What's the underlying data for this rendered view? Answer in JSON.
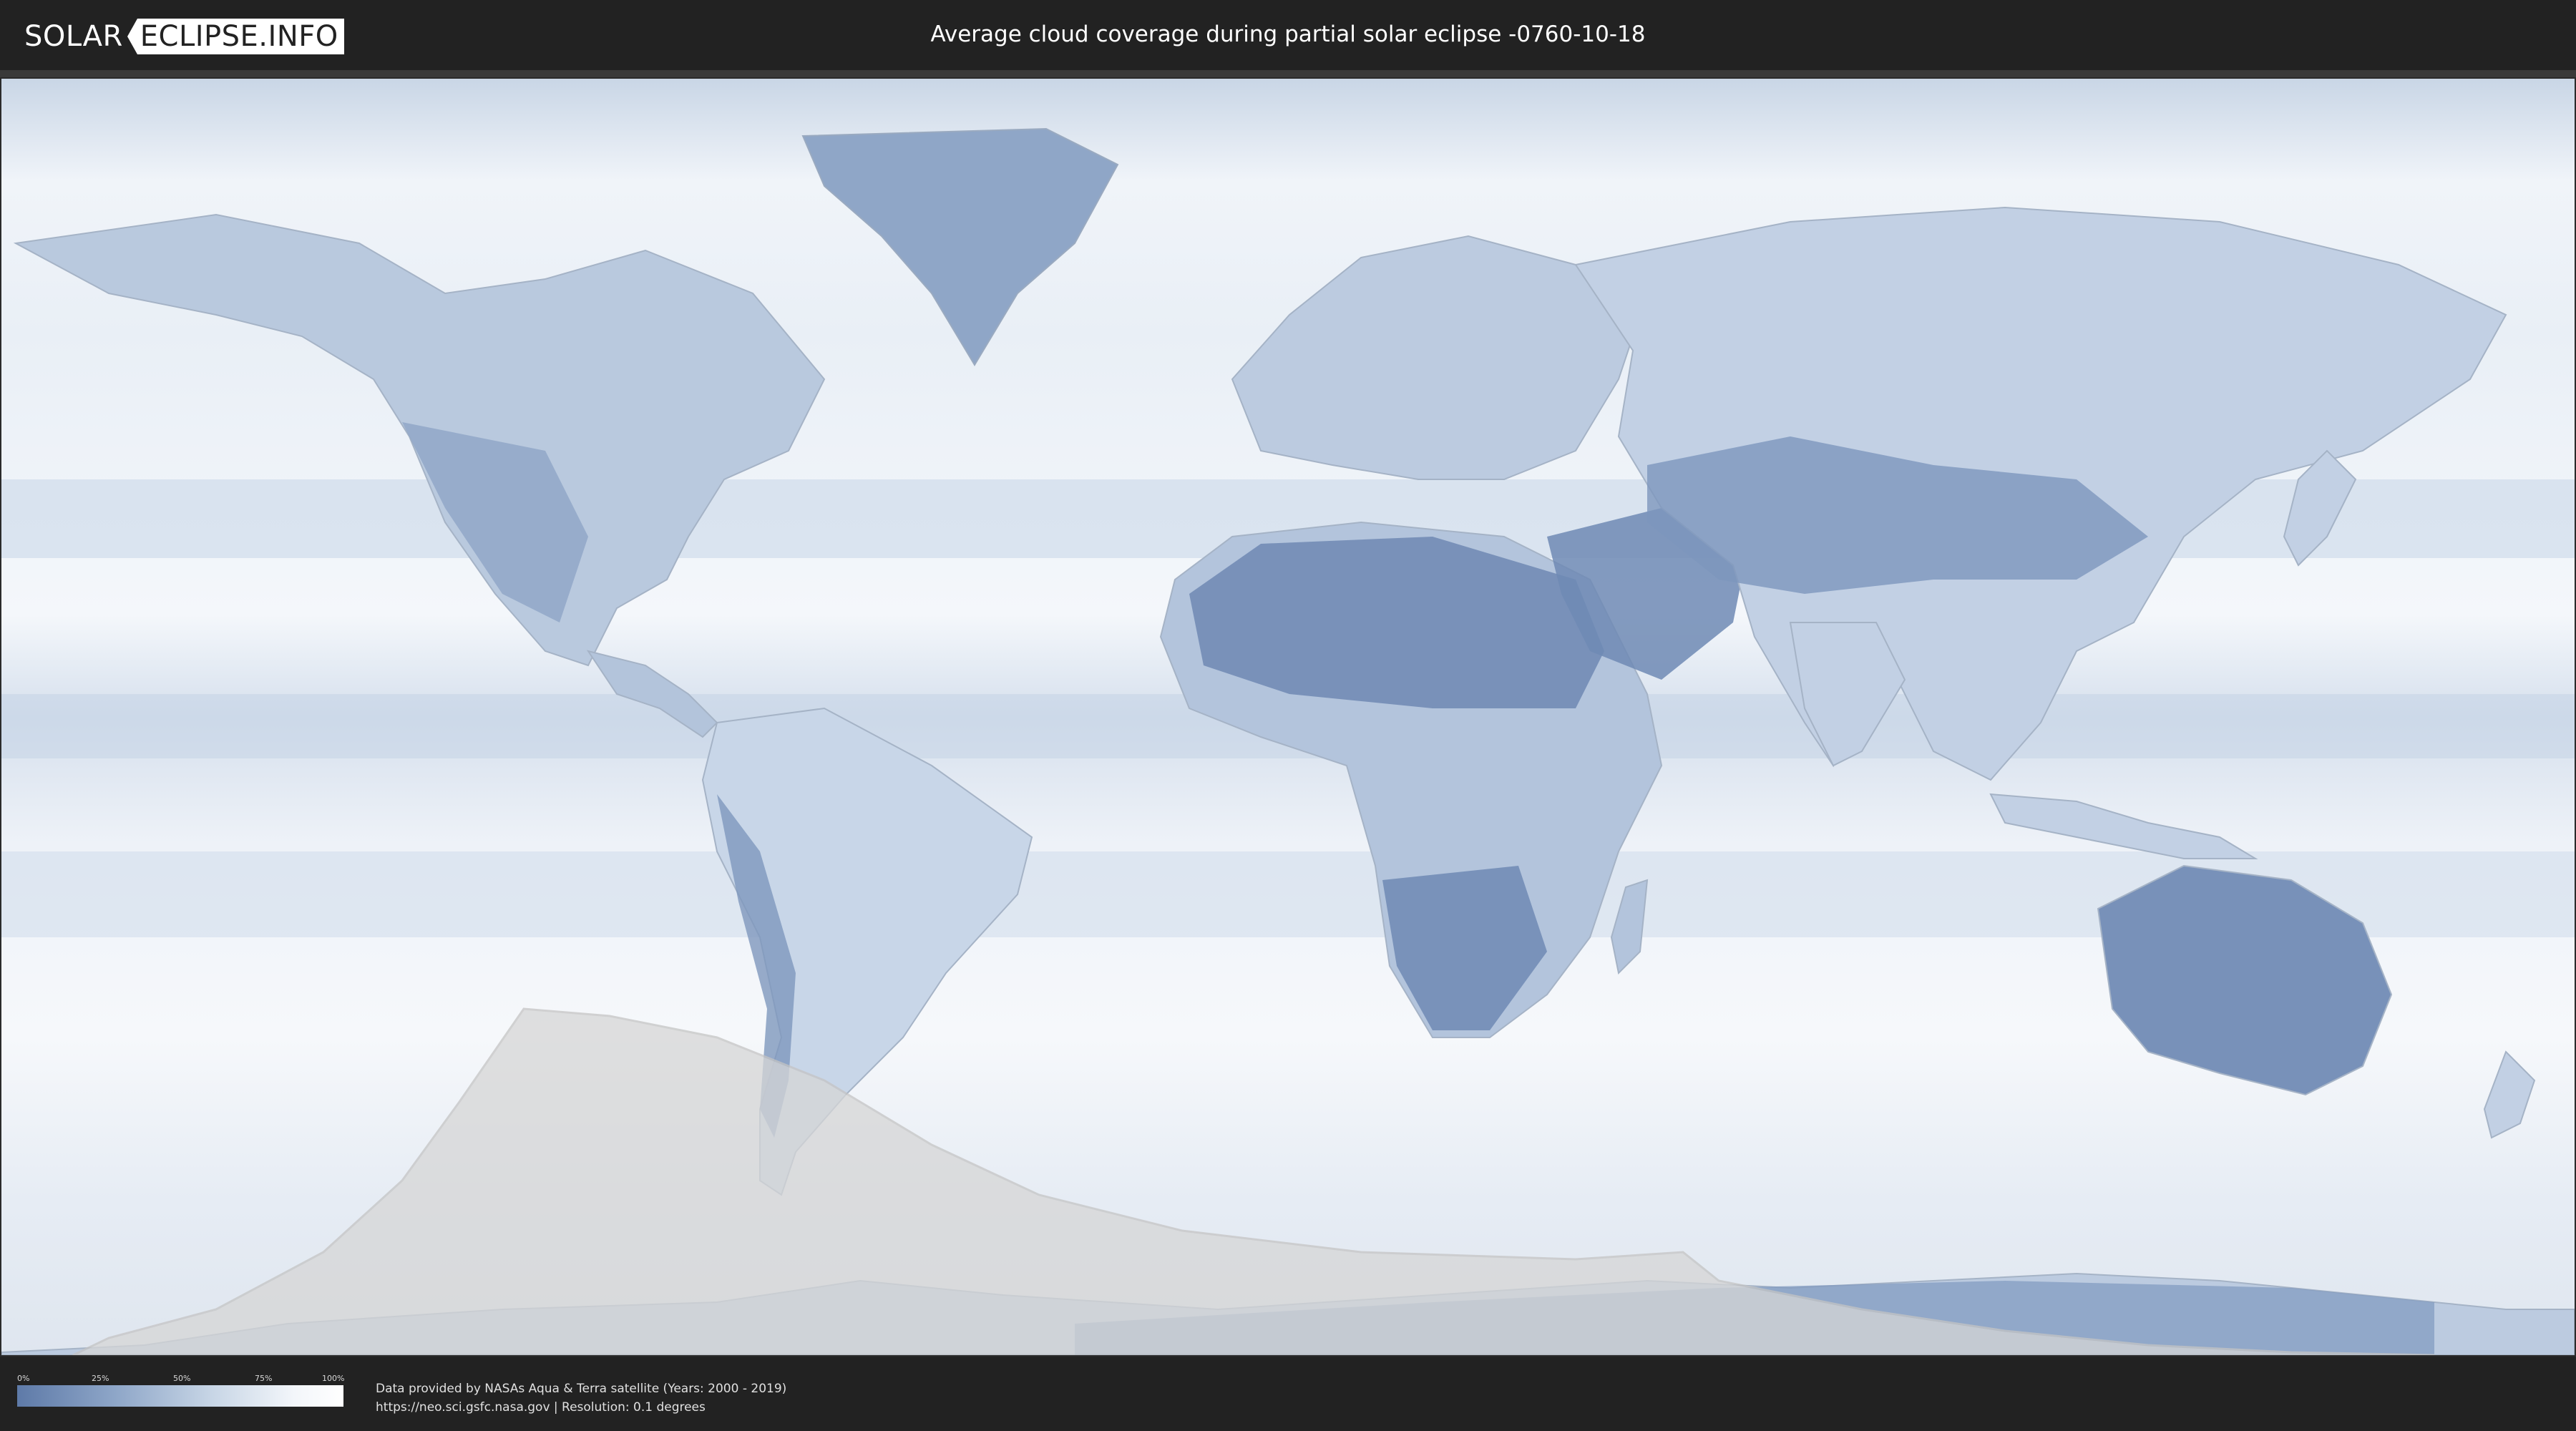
{
  "header": {
    "logo_left": "SOLAR",
    "logo_right": "ECLIPSE.INFO",
    "title": "Average cloud coverage during partial solar eclipse -0760-10-18"
  },
  "legend": {
    "ticks": [
      "0%",
      "25%",
      "50%",
      "75%",
      "100%"
    ],
    "colors": [
      "#5e7aa8",
      "#ffffff"
    ]
  },
  "footer": {
    "credit_line1": "Data provided by NASAs Aqua & Terra satellite (Years: 2000 - 2019)",
    "credit_line2": "https://neo.sci.gsfc.nasa.gov | Resolution: 0.1 degrees"
  },
  "map": {
    "projection": "equirectangular",
    "eclipse_zone": "southern hemisphere (South Pacific, southern South America, Antarctica)",
    "colors": {
      "clear": "#5e7aa8",
      "cloudy": "#ffffff",
      "eclipse_overlay": "#d8d8d8"
    }
  }
}
